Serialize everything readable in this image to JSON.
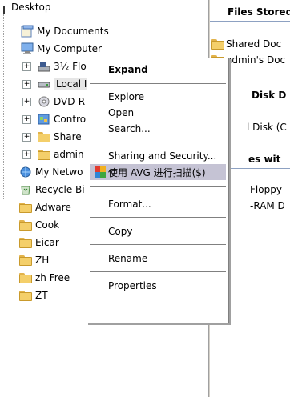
{
  "tree": {
    "items": [
      {
        "label": "Desktop"
      },
      {
        "label": "My Documents"
      },
      {
        "label": "My Computer"
      },
      {
        "label": "3½ Floppy (A:)"
      },
      {
        "label": "Local I"
      },
      {
        "label": "DVD-R"
      },
      {
        "label": "Contro"
      },
      {
        "label": "Share"
      },
      {
        "label": "admin"
      },
      {
        "label": "My Netwo"
      },
      {
        "label": "Recycle Bi"
      },
      {
        "label": "Adware"
      },
      {
        "label": "Cook"
      },
      {
        "label": "Eicar"
      },
      {
        "label": "ZH"
      },
      {
        "label": "zh Free"
      },
      {
        "label": "ZT"
      }
    ]
  },
  "right_pane": {
    "header1": "Files Stored",
    "items1": [
      "Shared Doc",
      "admin's Doc"
    ],
    "header2": "Disk D",
    "item2": "l Disk (C",
    "header3": "es wit",
    "items3": [
      "Floppy",
      "-RAM D"
    ]
  },
  "context_menu": {
    "expand": "Expand",
    "explore": "Explore",
    "open": "Open",
    "search": "Search...",
    "sharing": "Sharing and Security...",
    "avg_scan": "使用 AVG 进行扫描($)",
    "format": "Format...",
    "copy": "Copy",
    "rename": "Rename",
    "properties": "Properties"
  },
  "colors": {
    "highlight": "#c5c3d4",
    "folder": "#f4cf6a"
  }
}
